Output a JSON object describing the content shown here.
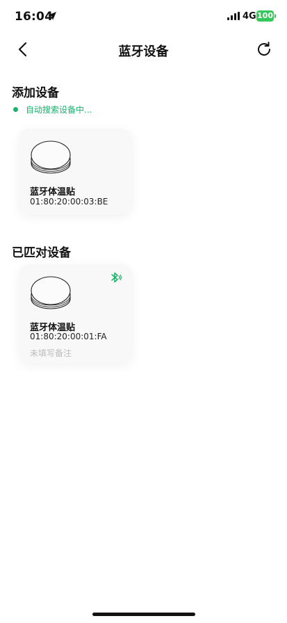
{
  "status_bar": {
    "time": "16:04",
    "network": "4G",
    "battery": "100"
  },
  "header": {
    "title": "蓝牙设备"
  },
  "add_section": {
    "title": "添加设备",
    "scan_status": "自动搜索设备中...",
    "devices": [
      {
        "name": "蓝牙体温贴",
        "mac": "01:80:20:00:03:BE"
      }
    ]
  },
  "paired_section": {
    "title": "已匹对设备",
    "devices": [
      {
        "name": "蓝牙体温贴",
        "mac": "01:80:20:00:01:FA",
        "remark": "未填写备注",
        "icon": "bluetooth-icon"
      }
    ]
  },
  "colors": {
    "accent": "#16b36a",
    "battery": "#34c759"
  },
  "icons": [
    "location-arrow-icon",
    "signal-icon",
    "battery-icon",
    "back-arrow-icon",
    "refresh-icon",
    "device-icon",
    "bluetooth-icon"
  ]
}
